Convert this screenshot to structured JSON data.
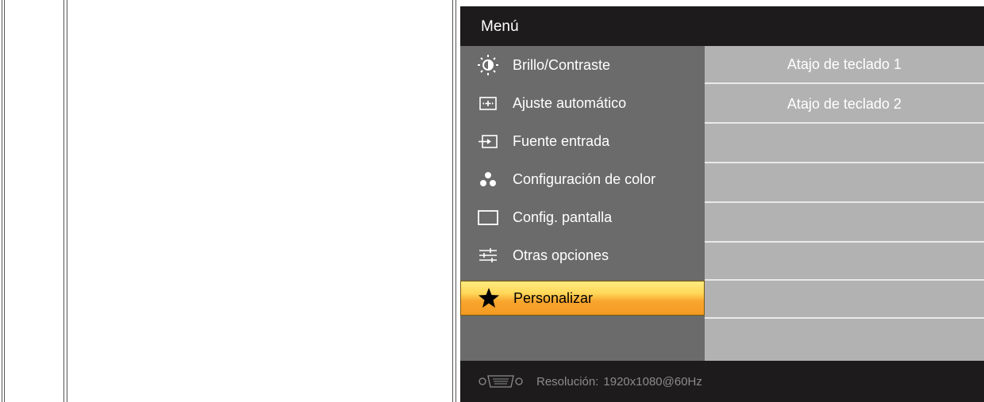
{
  "osd": {
    "title": "Menú",
    "menu_items": [
      {
        "label": "Brillo/Contraste",
        "icon": "brightness-contrast-icon"
      },
      {
        "label": "Ajuste automático",
        "icon": "auto-adjust-icon"
      },
      {
        "label": "Fuente entrada",
        "icon": "input-source-icon"
      },
      {
        "label": "Configuración de color",
        "icon": "color-settings-icon"
      },
      {
        "label": "Config. pantalla",
        "icon": "display-settings-icon"
      },
      {
        "label": "Otras opciones",
        "icon": "other-settings-icon"
      },
      {
        "label": "Personalizar",
        "icon": "star-icon",
        "selected": true
      }
    ],
    "submenu": [
      {
        "label": "Atajo de teclado 1"
      },
      {
        "label": "Atajo de teclado 2"
      },
      {
        "label": ""
      },
      {
        "label": ""
      },
      {
        "label": ""
      },
      {
        "label": ""
      },
      {
        "label": ""
      },
      {
        "label": ""
      }
    ],
    "footer": {
      "connector_icon": "vga-connector-icon",
      "resolution_label": "Resolución:",
      "resolution_value": "1920x1080@60Hz"
    },
    "colors": {
      "background": "#1d1b1b",
      "left_panel": "#6b6b6b",
      "right_panel": "#b2b2b2",
      "highlight": "#f8a52e"
    }
  }
}
